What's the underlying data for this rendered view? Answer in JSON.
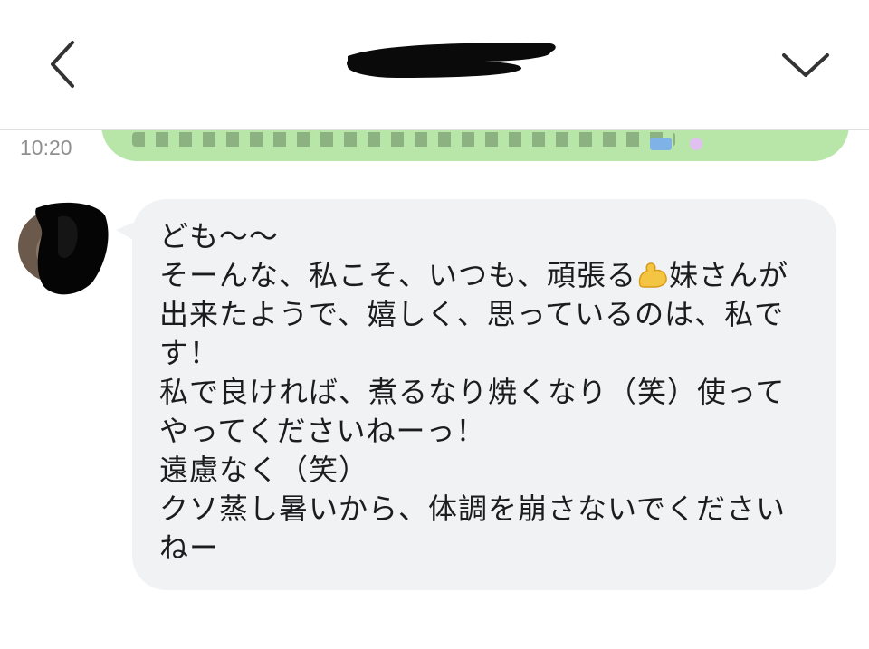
{
  "header": {
    "back_icon": "chevron-left-icon",
    "menu_icon": "chevron-down-icon",
    "title_redacted": true
  },
  "chat": {
    "sent_message": {
      "time": "10:20",
      "color": "#b8e6a8"
    },
    "received_message": {
      "bubble_color": "#f1f2f4",
      "lines": [
        "ども〜〜",
        "そーんな、私こそ、いつも、頑張る",
        "妹さんが",
        "出来たようで、嬉しく、思っているのは、私で",
        "す！",
        "私で良ければ、煮るなり焼くなり（笑）使って",
        "やってくださいねーっ！",
        "遠慮なく（笑）",
        "クソ蒸し暑いから、体調を崩さないでください",
        "ねー"
      ],
      "emoji_icon": "flexed-biceps-icon"
    }
  }
}
